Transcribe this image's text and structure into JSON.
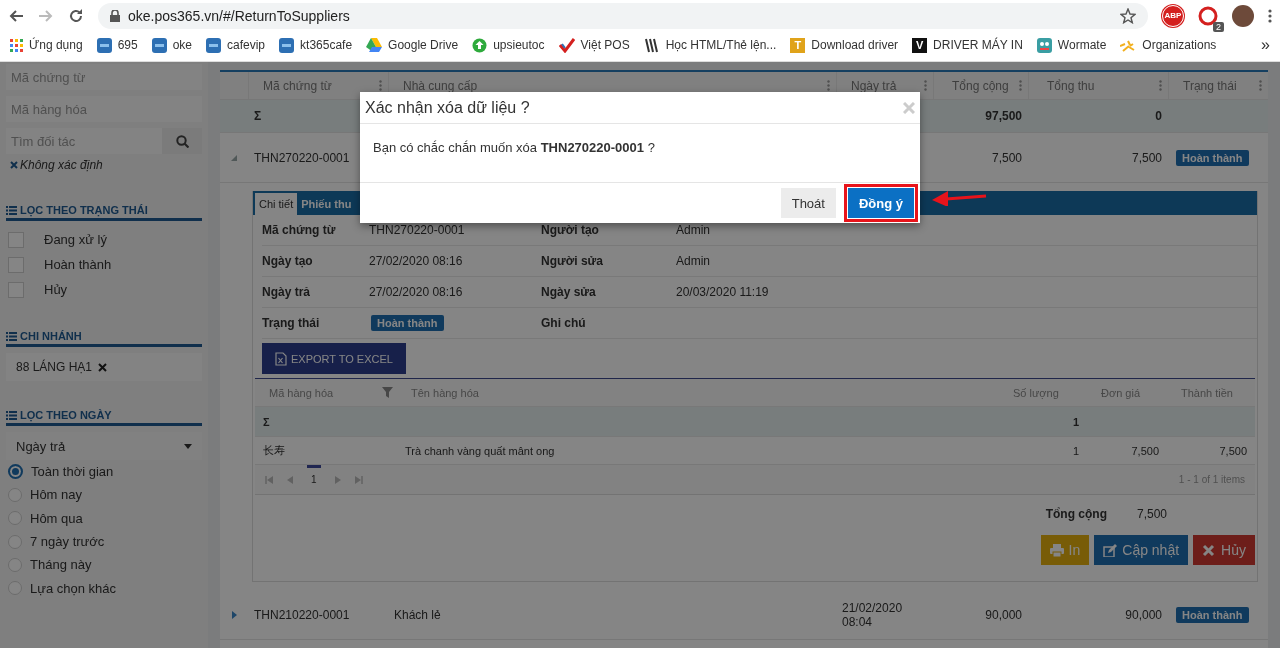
{
  "browser": {
    "url": "oke.pos365.vn/#/ReturnToSuppliers",
    "abp_label": "ABP",
    "extension_badge": "2",
    "more": "»",
    "bookmarks": [
      {
        "label": "Ứng dụng",
        "kind": "apps"
      },
      {
        "label": "695",
        "kind": "pos"
      },
      {
        "label": "oke",
        "kind": "pos"
      },
      {
        "label": "cafevip",
        "kind": "pos"
      },
      {
        "label": "kt365cafe",
        "kind": "pos"
      },
      {
        "label": "Google Drive",
        "kind": "drive"
      },
      {
        "label": "upsieutoc",
        "kind": "up"
      },
      {
        "label": "Việt POS",
        "kind": "check"
      },
      {
        "label": "Học HTML/Thẻ lện...",
        "kind": "book"
      },
      {
        "label": "Download driver",
        "kind": "letter",
        "letter": "T",
        "color": "#e0a31a"
      },
      {
        "label": "DRIVER MÁY IN",
        "kind": "letter",
        "letter": "V",
        "color": "#111111"
      },
      {
        "label": "Wormate",
        "kind": "game"
      },
      {
        "label": "Organizations",
        "kind": "spark"
      }
    ]
  },
  "sidebar": {
    "fields": [
      {
        "placeholder": "Mã chứng từ",
        "kind": "text"
      },
      {
        "placeholder": "Mã hàng hóa",
        "kind": "text"
      },
      {
        "placeholder": "Tìm đối tác",
        "kind": "search"
      }
    ],
    "partner_tag": "Không xác định",
    "status_filter": {
      "title": "LỌC THEO TRẠNG THÁI",
      "options": [
        {
          "label": "Đang xử lý",
          "checked": false
        },
        {
          "label": "Hoàn thành",
          "checked": false
        },
        {
          "label": "Hủy",
          "checked": false
        }
      ]
    },
    "branch_filter": {
      "title": "CHI NHÁNH",
      "chips": [
        "88 LÁNG HẠ1"
      ]
    },
    "date_filter": {
      "title": "LỌC THEO NGÀY",
      "select": "Ngày trả",
      "options": [
        {
          "label": "Toàn thời gian",
          "selected": true
        },
        {
          "label": "Hôm nay",
          "selected": false
        },
        {
          "label": "Hôm qua",
          "selected": false
        },
        {
          "label": "7 ngày trước",
          "selected": false
        },
        {
          "label": "Tháng này",
          "selected": false
        },
        {
          "label": "Lựa chọn khác",
          "selected": false
        }
      ]
    }
  },
  "table": {
    "columns": [
      "Mã chứng từ",
      "Nhà cung cấp",
      "Ngày trả",
      "Tổng cộng",
      "Tổng thu",
      "Trạng thái"
    ],
    "summary": {
      "label": "Σ",
      "total": "97,500",
      "paid": "0"
    },
    "rows": [
      {
        "code": "THN270220-0001",
        "total": "7,500",
        "paid": "7,500",
        "status": "Hoàn thành",
        "expanded": true,
        "detail": {
          "tabs": [
            {
              "label": "Chi tiết",
              "selected": true
            },
            {
              "label": "Phiếu thu",
              "selected": false
            }
          ],
          "fields": [
            {
              "label": "Mã chứng từ",
              "value": "THN270220-0001",
              "kind": "text"
            },
            {
              "label": "Người tạo",
              "value": "Admin",
              "kind": "text"
            },
            {
              "label": "Ngày tạo",
              "value": "27/02/2020 08:16",
              "kind": "text"
            },
            {
              "label": "Người sửa",
              "value": "Admin",
              "kind": "text"
            },
            {
              "label": "Ngày trả",
              "value": "27/02/2020 08:16",
              "kind": "text"
            },
            {
              "label": "Ngày sửa",
              "value": "20/03/2020 11:19",
              "kind": "text"
            },
            {
              "label": "Trạng thái",
              "value": "Hoàn thành",
              "kind": "badge"
            },
            {
              "label": "Ghi chú"
            }
          ],
          "export_button": "EXPORT TO EXCEL",
          "items": {
            "columns": [
              "Mã hàng hóa",
              "Tên hàng hóa",
              "Số lượng",
              "Đơn giá",
              "Thành tiền"
            ],
            "summary": {
              "label": "Σ",
              "quantity": "1"
            },
            "rows": [
              {
                "code": "长寿",
                "name": "Trà chanh vàng quất mânt ong",
                "quantity": "1",
                "price": "7,500",
                "amount": "7,500"
              }
            ],
            "pager": {
              "pages": [
                {
                  "label": "1",
                  "selected": true
                }
              ],
              "info": "1 - 1 of 1 items"
            }
          },
          "total": {
            "label": "Tổng cộng",
            "value": "7,500"
          },
          "actions": [
            {
              "label": "In",
              "kind": "print"
            },
            {
              "label": "Cập nhật",
              "kind": "update"
            },
            {
              "label": "Hủy",
              "kind": "cancel"
            }
          ]
        }
      },
      {
        "code": "THN210220-0001",
        "supplier": "Khách lẻ",
        "date": "21/02/2020 08:04",
        "total": "90,000",
        "paid": "90,000",
        "status": "Hoàn thành",
        "expanded": false
      }
    ]
  },
  "dialog": {
    "title": "Xác nhận xóa dữ liệu ?",
    "message": "Bạn có chắc chắn muốn xóa **THN270220-0001** ?",
    "buttons": [
      {
        "label": "Thoát",
        "kind": "secondary",
        "highlighted": false
      },
      {
        "label": "Đồng ý",
        "kind": "primary",
        "highlighted": true
      }
    ]
  }
}
